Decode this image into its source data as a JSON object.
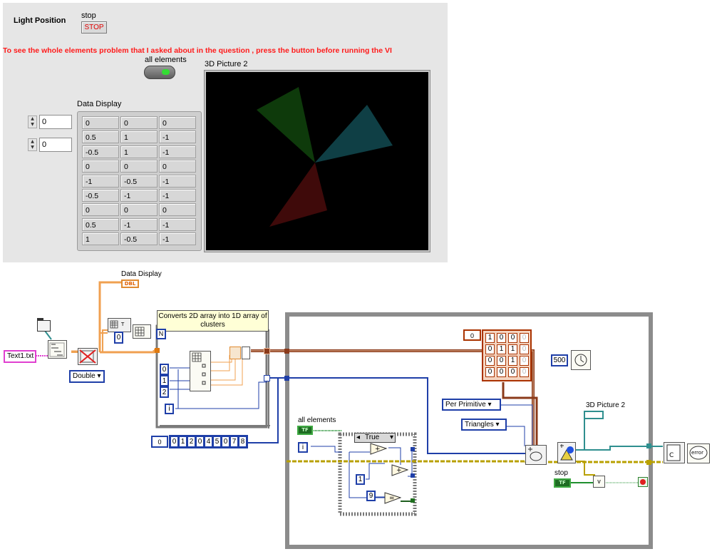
{
  "front_panel": {
    "light_position_label": "Light Position",
    "stop_label": "stop",
    "stop_button": "STOP",
    "warning_text": "To see the whole elements problem that I asked about in the question , press the button before running the VI",
    "all_elements_label": "all elements",
    "picture_label": "3D Picture 2",
    "data_display_label": "Data Display",
    "index_row": "0",
    "index_col": "0",
    "table": [
      [
        "0",
        "0",
        "0"
      ],
      [
        "0.5",
        "1",
        "-1"
      ],
      [
        "-0.5",
        "1",
        "-1"
      ],
      [
        "0",
        "0",
        "0"
      ],
      [
        "-1",
        "-0.5",
        "-1"
      ],
      [
        "-0.5",
        "-1",
        "-1"
      ],
      [
        "0",
        "0",
        "0"
      ],
      [
        "0.5",
        "-1",
        "-1"
      ],
      [
        "1",
        "-0.5",
        "-1"
      ]
    ],
    "triangle_colors": {
      "green": "#0e3a0b",
      "teal": "#0f3f45",
      "red": "#3f0a0a"
    }
  },
  "block_diagram": {
    "data_display_label": "Data Display",
    "dbl_terminal": "DBL",
    "file_name": "Text1.txt",
    "type_select": "Double ▾",
    "comment": "Converts 2D array into 1D array of clusters",
    "n_label": "N",
    "const_zero": "0",
    "index_consts": [
      "0",
      "1",
      "2"
    ],
    "i_label": "i",
    "array_index": "0",
    "array_values": [
      "0",
      "1",
      "2",
      "0",
      "4",
      "5",
      "0",
      "7",
      "8"
    ],
    "matrix_index": "0",
    "matrix": [
      [
        "1",
        "0",
        "0",
        "0"
      ],
      [
        "0",
        "1",
        "1",
        "0"
      ],
      [
        "0",
        "0",
        "1",
        "0"
      ],
      [
        "0",
        "0",
        "0",
        "0"
      ]
    ],
    "wait_const": "500",
    "per_primitive": "Per Primitive ▾",
    "triangles": "Triangles ▾",
    "all_elements_label": "all elements",
    "tf": "TF",
    "case_label": "True",
    "const_one": "1",
    "const_nine": "9",
    "picture_label": "3D Picture 2",
    "stop_label": "stop",
    "or_label": "v",
    "error_label": "error"
  }
}
